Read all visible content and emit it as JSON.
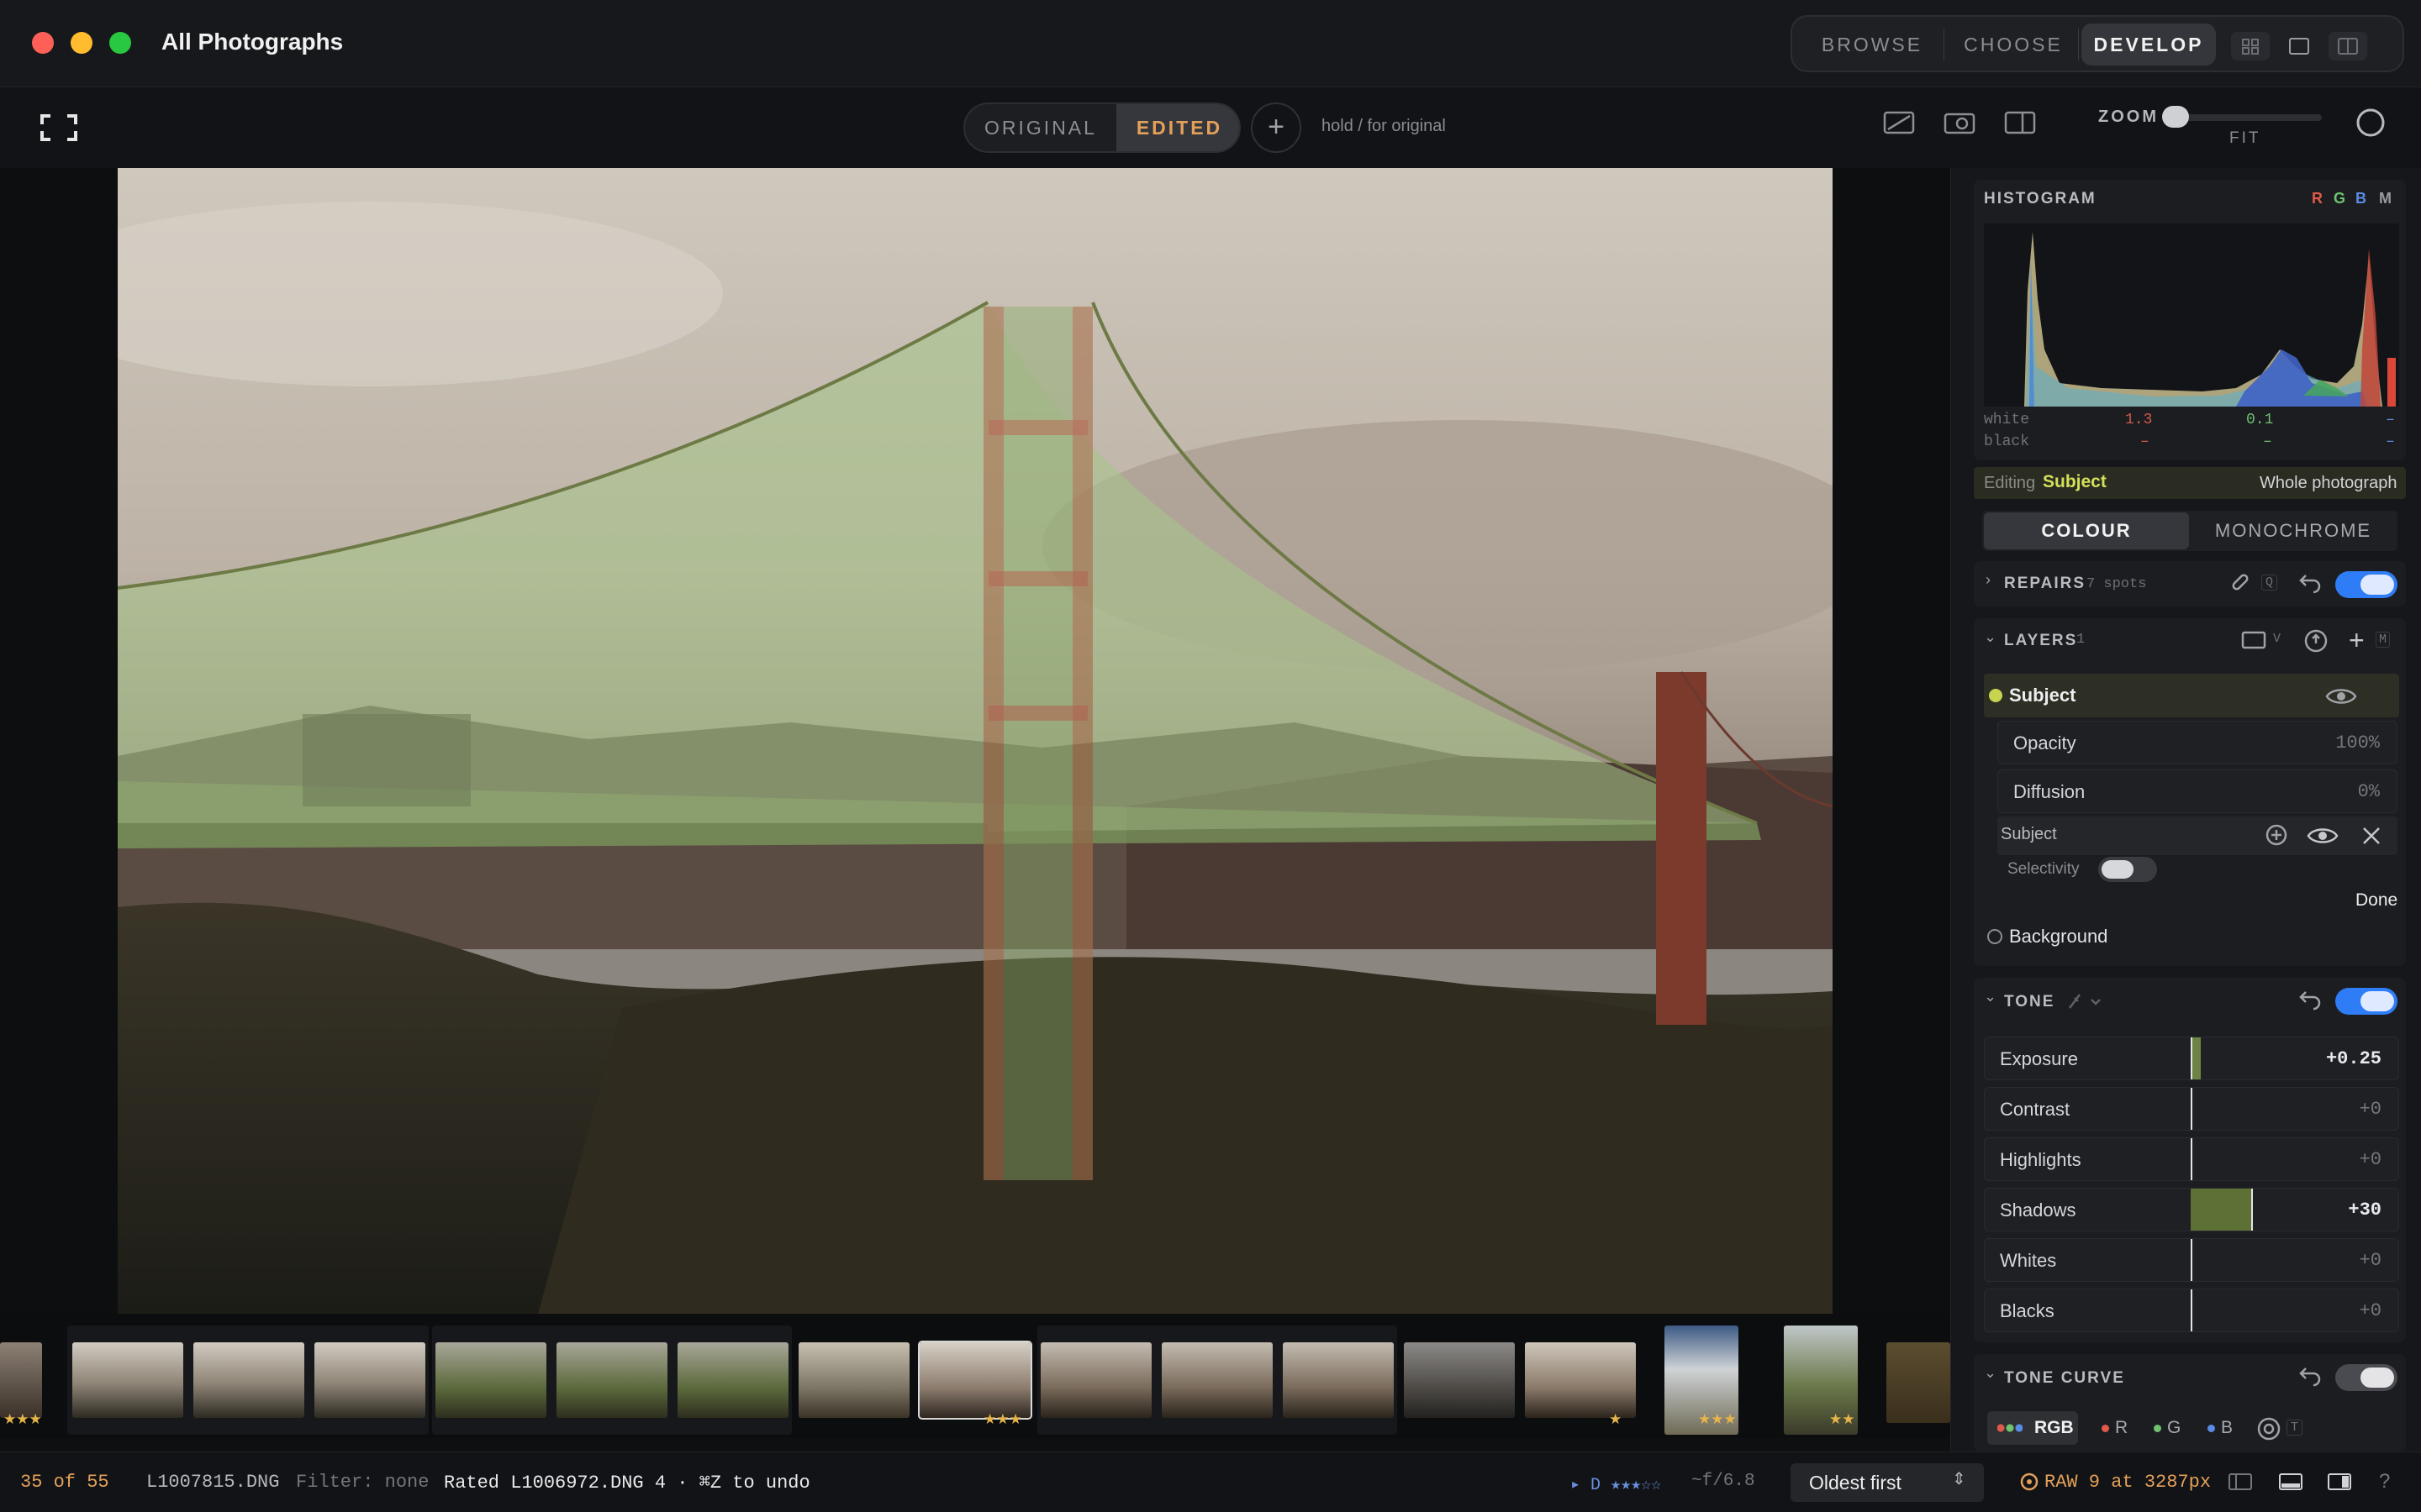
{
  "window": {
    "title": "All Photographs"
  },
  "modes": [
    {
      "label": "BROWSE"
    },
    {
      "label": "CHOOSE"
    },
    {
      "label": "DEVELOP",
      "active": true
    }
  ],
  "toolbar": {
    "original_label": "ORIGINAL",
    "edited_label": "EDITED",
    "plus_label": "+",
    "hold_hint": "hold / for original",
    "zoom_label": "ZOOM",
    "zoom_value": "FIT"
  },
  "histogram": {
    "title": "HISTOGRAM",
    "channels": [
      "R",
      "G",
      "B",
      "M"
    ],
    "white_label": "white",
    "black_label": "black",
    "white_values": [
      "1.3",
      "0.1",
      "–"
    ],
    "black_values": [
      "–",
      "–",
      "–"
    ]
  },
  "editing": {
    "prefix": "Editing",
    "target": "Subject",
    "whole": "Whole photograph"
  },
  "colour_tabs": {
    "colour": "COLOUR",
    "mono": "MONOCHROME"
  },
  "repairs": {
    "title": "REPAIRS",
    "count": "7 spots",
    "shortcut": "Q"
  },
  "layers": {
    "title": "LAYERS",
    "count": "1",
    "shortcut_v": "V",
    "shortcut_m": "M",
    "subject": "Subject",
    "opacity_label": "Opacity",
    "opacity_value": "100%",
    "diffusion_label": "Diffusion",
    "diffusion_value": "0%",
    "mask_label": "Subject",
    "selectivity_label": "Selectivity",
    "done_label": "Done",
    "background": "Background"
  },
  "tone": {
    "title": "TONE",
    "sliders": [
      {
        "label": "Exposure",
        "value": "+0.25"
      },
      {
        "label": "Contrast",
        "value": "+0"
      },
      {
        "label": "Highlights",
        "value": "+0"
      },
      {
        "label": "Shadows",
        "value": "+30"
      },
      {
        "label": "Whites",
        "value": "+0"
      },
      {
        "label": "Blacks",
        "value": "+0"
      }
    ]
  },
  "tone_curve": {
    "title": "TONE CURVE",
    "channels": [
      "RGB",
      "R",
      "G",
      "B"
    ],
    "shortcut": "T"
  },
  "filmstrip": {
    "ratings": [
      "★★★",
      "★★★",
      "★",
      "★★★",
      "★★"
    ]
  },
  "status": {
    "position": "35 of 55",
    "filename": "L1007815.DNG",
    "filter": "Filter: none",
    "message": "Rated L1006972.DNG 4 · ⌘Z to undo",
    "flags": "▸ D ★★★☆☆",
    "aperture": "~f/6.8",
    "sort": "Oldest first",
    "raw_info": "RAW 9 at 3287px",
    "help": "?"
  },
  "colors": {
    "accent": "#e3a05a",
    "toggle": "#2e7df6",
    "mask": "#9fc27a"
  }
}
